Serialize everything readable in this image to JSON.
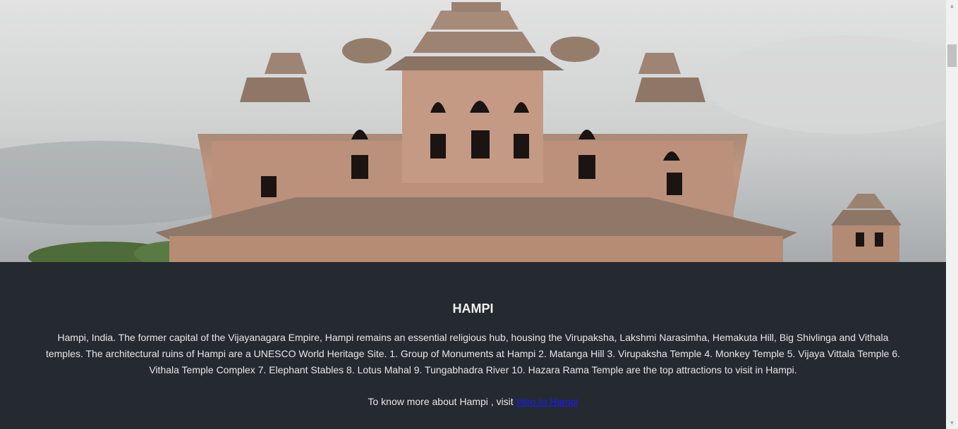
{
  "hero": {
    "image": "Lotus Mahal, Hampi"
  },
  "article": {
    "title": "HAMPI",
    "description": "Hampi, India. The former capital of the Vijayanagara Empire, Hampi remains an essential religious hub, housing the Virupaksha, Lakshmi Narasimha, Hemakuta Hill, Big Shivlinga and Vithala temples. The architectural ruins of Hampi are a UNESCO World Heritage Site. 1. Group of Monuments at Hampi 2. Matanga Hill 3. Virupaksha Temple 4. Monkey Temple 5. Vijaya Vittala Temple 6. Vithala Temple Complex 7. Elephant Stables 8. Lotus Mahal 9. Tungabhadra River 10. Hazara Rama Temple are the top attractions to visit in Hampi.",
    "more_prefix": "To know more about Hampi , visit ",
    "more_link": "Intro to Hampi"
  },
  "scrollbar": {
    "up_icon": "▲",
    "down_icon": "▼"
  }
}
